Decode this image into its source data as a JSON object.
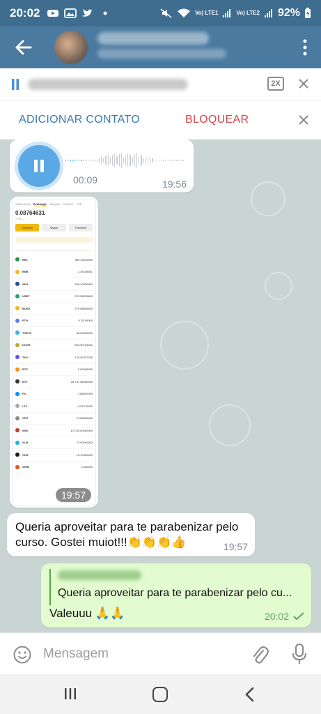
{
  "status_bar": {
    "time": "20:02",
    "battery": "92%",
    "network_labels": [
      "Vo) LTE1",
      "Vo) LTE2"
    ]
  },
  "header": {
    "contact_name": "",
    "contact_status": ""
  },
  "player": {
    "speed_label": "2X",
    "track_title": ""
  },
  "actions": {
    "add_contact_label": "ADICIONAR CONTATO",
    "block_label": "BLOQUEAR"
  },
  "messages": {
    "voice": {
      "duration": "00:09",
      "time": "19:56"
    },
    "photo": {
      "time": "19:57",
      "screenshot": {
        "tabs": [
          "Visão Geral",
          "Exchange",
          "Margem",
          "Futuros",
          "P2P"
        ],
        "balance": "0.08764631",
        "buttons": [
          "Depósito",
          "Saque",
          "Transferir"
        ],
        "coins": [
          {
            "sym": "BRL",
            "amt": "950.40110000",
            "color": "#2e8b57"
          },
          {
            "sym": "BNB",
            "amt": "2.43146651",
            "color": "#f0b90b"
          },
          {
            "sym": "ADA",
            "amt": "260.10000000",
            "color": "#2a4d9b"
          },
          {
            "sym": "USDT",
            "amt": "370.35229600",
            "color": "#26a17b"
          },
          {
            "sym": "BUSD",
            "amt": "279.58864663",
            "color": "#f0b90b"
          },
          {
            "sym": "ETH",
            "amt": "0.11195000",
            "color": "#627eea"
          },
          {
            "sym": "THETA",
            "amt": "36.00000000",
            "color": "#2ab8e6"
          },
          {
            "sym": "DOGE",
            "amt": "693.90751202",
            "color": "#c2a633"
          },
          {
            "sym": "TKO",
            "amt": "129.92327536",
            "color": "#6a4cff"
          },
          {
            "sym": "BTC",
            "amt": "0.00606950",
            "color": "#f7931a"
          },
          {
            "sym": "BTT",
            "amt": "28,737.86300000",
            "color": "#333333"
          },
          {
            "sym": "FIL",
            "amt": "1.66830000",
            "color": "#0090ff"
          },
          {
            "sym": "LTC",
            "amt": "0.51270000",
            "color": "#a6a9aa"
          },
          {
            "sym": "ORT",
            "amt": "74.56000000",
            "color": "#8a8a8a"
          },
          {
            "sym": "WIN",
            "amt": "87,750.00000000",
            "color": "#c0392b"
          },
          {
            "sym": "XLM",
            "amt": "73.90000000",
            "color": "#14b6e7"
          },
          {
            "sym": "CHR",
            "amt": "15.10000000",
            "color": "#1d1d1d"
          },
          {
            "sym": "SHIB",
            "amt": "0.000000",
            "color": "#e0531f"
          }
        ]
      }
    },
    "incoming_text": "Queria aproveitar para te parabenizar pelo curso. Gostei muiot!!!👏👏👏👍",
    "incoming_time": "19:57",
    "reply_preview": "Queria aproveitar para te parabenizar pelo cu...",
    "outgoing_text": "Valeuuu 🙏🙏",
    "outgoing_time": "20:02"
  },
  "composer": {
    "placeholder": "Mensagem"
  },
  "colors": {
    "header": "#4a7aa0",
    "accent_blue": "#3a7bb0",
    "danger_red": "#d64545",
    "outgoing_bubble": "#e2fbcf",
    "chat_background": "#c8d5d2"
  },
  "icons": [
    "back-arrow-icon",
    "menu-dots-icon",
    "pause-icon",
    "close-icon",
    "emoji-icon",
    "paperclip-icon",
    "microphone-icon",
    "double-check-icon"
  ]
}
